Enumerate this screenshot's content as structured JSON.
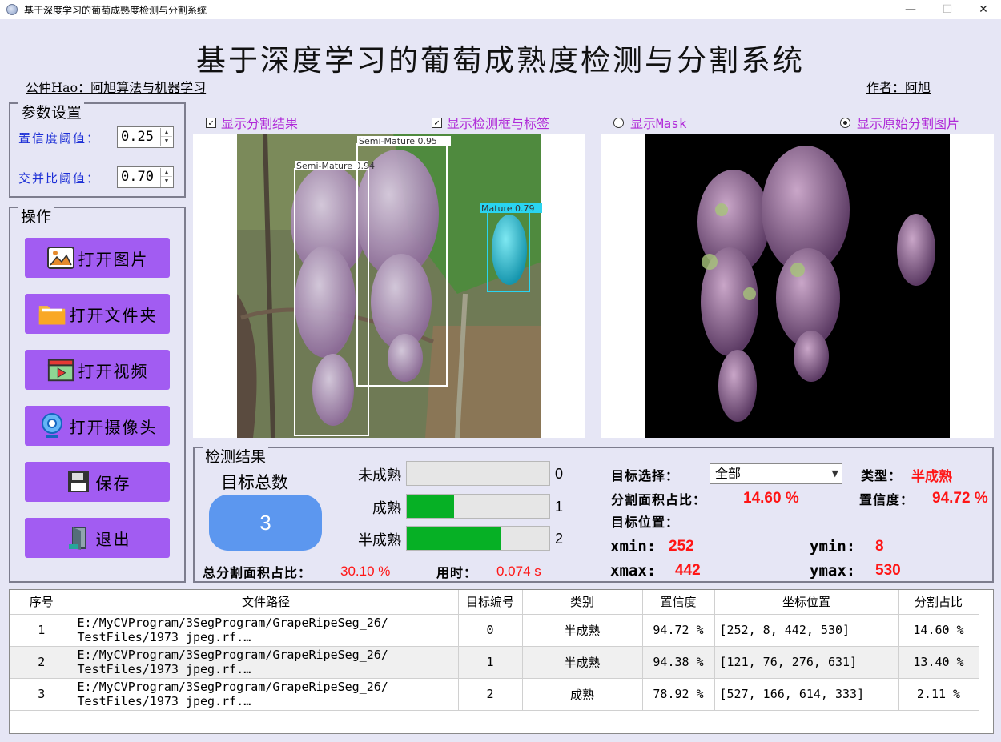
{
  "window": {
    "title": "基于深度学习的葡萄成熟度检测与分割系统",
    "controls": [
      "—",
      "☐",
      "✕"
    ]
  },
  "header": {
    "title": "基于深度学习的葡萄成熟度检测与分割系统",
    "left_link": "公仲Hao：阿旭算法与机器学习",
    "right_link": "作者：阿旭"
  },
  "params": {
    "group_title": "参数设置",
    "confidence_label": "置信度阈值：",
    "confidence_value": "0.25",
    "iou_label": "交并比阈值：",
    "iou_value": "0.70"
  },
  "operations": {
    "group_title": "操作",
    "buttons": [
      {
        "label": "打开图片",
        "icon": "image-icon"
      },
      {
        "label": "打开文件夹",
        "icon": "folder-icon"
      },
      {
        "label": "打开视频",
        "icon": "video-icon"
      },
      {
        "label": "打开摄像头",
        "icon": "camera-icon"
      },
      {
        "label": "保存",
        "icon": "save-icon"
      },
      {
        "label": "退出",
        "icon": "exit-icon"
      }
    ]
  },
  "display_options": {
    "show_seg": "显示分割结果",
    "show_boxes": "显示检测框与标签",
    "show_mask": "显示Mask",
    "show_original_seg": "显示原始分割图片"
  },
  "detection_image": {
    "boxes": [
      {
        "label": "Semi-Mature 0.95",
        "color": "#ffffff"
      },
      {
        "label": "Semi-Mature 0.94",
        "color": "#ffffff"
      },
      {
        "label": "Mature 0.79",
        "color": "#2ad4f0"
      }
    ]
  },
  "results": {
    "group_title": "检测结果",
    "total_label": "目标总数",
    "total_value": "3",
    "bars": [
      {
        "label": "未成熟",
        "value": "0",
        "fill": 0
      },
      {
        "label": "成熟",
        "value": "1",
        "fill": 0.33
      },
      {
        "label": "半成熟",
        "value": "2",
        "fill": 0.66
      }
    ],
    "total_area_label": "总分割面积占比：",
    "total_area_value": "30.10 %",
    "time_label": "用时：",
    "time_value": "0.074 s",
    "target_select_label": "目标选择：",
    "target_select_value": "全部",
    "type_label": "类型：",
    "type_value": "半成熟",
    "area_ratio_label": "分割面积占比：",
    "area_ratio_value": "14.60 %",
    "conf_label": "置信度：",
    "conf_value": "94.72 %",
    "position_label": "目标位置：",
    "xmin_label": "xmin:",
    "xmin_value": "252",
    "ymin_label": "ymin:",
    "ymin_value": "8",
    "xmax_label": "xmax:",
    "xmax_value": "442",
    "ymax_label": "ymax:",
    "ymax_value": "530"
  },
  "table": {
    "headers": [
      "序号",
      "文件路径",
      "目标编号",
      "类别",
      "置信度",
      "坐标位置",
      "分割占比"
    ],
    "rows": [
      {
        "idx": "1",
        "path1": "E:/MyCVProgram/3SegProgram/GrapeRipeSeg_26/",
        "path2": "TestFiles/1973_jpeg.rf.…",
        "target": "0",
        "cls": "半成熟",
        "conf": "94.72 %",
        "pos": "[252, 8, 442, 530]",
        "ratio": "14.60 %"
      },
      {
        "idx": "2",
        "path1": "E:/MyCVProgram/3SegProgram/GrapeRipeSeg_26/",
        "path2": "TestFiles/1973_jpeg.rf.…",
        "target": "1",
        "cls": "半成熟",
        "conf": "94.38 %",
        "pos": "[121, 76, 276, 631]",
        "ratio": "13.40 %"
      },
      {
        "idx": "3",
        "path1": "E:/MyCVProgram/3SegProgram/GrapeRipeSeg_26/",
        "path2": "TestFiles/1973_jpeg.rf.…",
        "target": "2",
        "cls": "成熟",
        "conf": "78.92 %",
        "pos": "[527, 166, 614, 333]",
        "ratio": "2.11 %"
      }
    ]
  }
}
